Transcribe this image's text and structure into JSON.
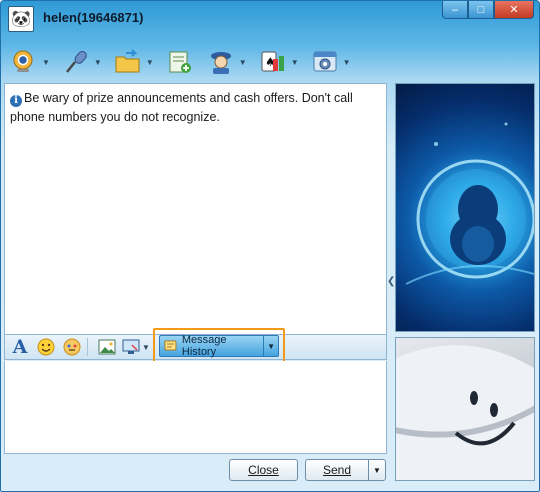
{
  "window": {
    "title": "helen(19646871)",
    "controls": {
      "minimize": "–",
      "maximize": "□",
      "close": "✕"
    }
  },
  "toolbar": {
    "items": [
      {
        "icon": "webcam-icon",
        "has_dropdown": true
      },
      {
        "icon": "microphone-icon",
        "has_dropdown": true
      },
      {
        "icon": "folder-transfer-icon",
        "has_dropdown": true
      },
      {
        "icon": "note-add-icon",
        "has_dropdown": false
      },
      {
        "icon": "remote-assist-icon",
        "has_dropdown": true
      },
      {
        "icon": "games-icon",
        "has_dropdown": true
      },
      {
        "icon": "app-settings-icon",
        "has_dropdown": true
      }
    ]
  },
  "chat": {
    "notice": "Be wary of prize announcements and cash offers. Don't call phone numbers you do not recognize."
  },
  "format_bar": {
    "font_label": "A",
    "message_history_label": "Message History"
  },
  "buttons": {
    "close_label": "Close",
    "send_label": "Send"
  },
  "colors": {
    "accent": "#2f9ad6",
    "highlight": "#f39a1b"
  }
}
